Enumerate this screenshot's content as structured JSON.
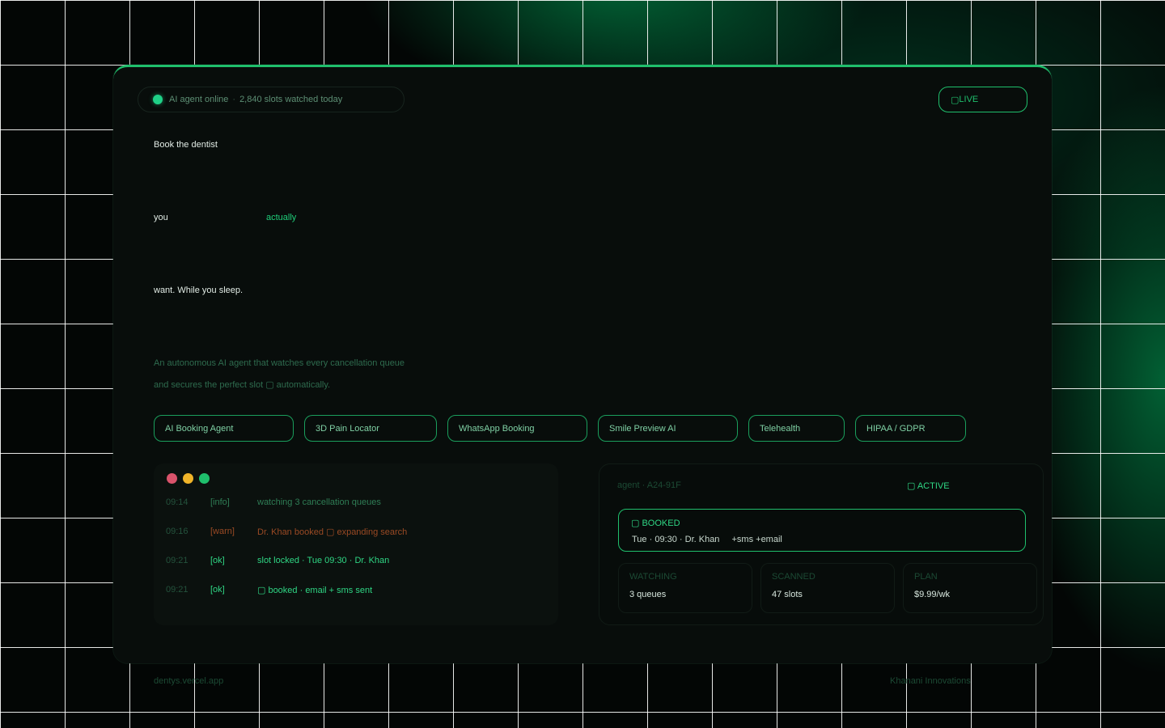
{
  "status": {
    "text": "AI agent online",
    "separator": "·",
    "slots": "2,840 slots watched today"
  },
  "live_badge": {
    "icon": "▢",
    "label": "LIVE"
  },
  "hero": {
    "line1": "Book the dentist",
    "line2": "you",
    "line2_accent": "actually",
    "line3": "want. While you sleep."
  },
  "description": {
    "line1": "An autonomous AI agent that watches every cancellation queue",
    "line2": "and secures the perfect slot ▢ automatically."
  },
  "features": [
    "AI Booking Agent",
    "3D Pain Locator",
    "WhatsApp Booking",
    "Smile Preview AI",
    "Telehealth",
    "HIPAA / GDPR"
  ],
  "terminal": {
    "logs": [
      {
        "time": "09:14",
        "level": "[info]",
        "message": "watching 3 cancellation queues",
        "kind": "info"
      },
      {
        "time": "09:16",
        "level": "[warn]",
        "message": "Dr. Khan booked ▢ expanding search",
        "kind": "warn"
      },
      {
        "time": "09:21",
        "level": "[ok]",
        "message": "slot locked · Tue 09:30 · Dr. Khan",
        "kind": "ok"
      },
      {
        "time": "09:21",
        "level": "[ok]",
        "message": "▢ booked · email + sms sent",
        "kind": "ok"
      }
    ]
  },
  "agent": {
    "id": "agent · A24-91F",
    "status": "▢ ACTIVE",
    "booked": {
      "title": "▢ BOOKED",
      "detail": "Tue · 09:30 · Dr. Khan",
      "extras": "+sms  +email"
    },
    "stats": [
      {
        "label": "WATCHING",
        "value": "3 queues"
      },
      {
        "label": "SCANNED",
        "value": "47 slots"
      },
      {
        "label": "PLAN",
        "value": "$9.99/wk"
      }
    ]
  },
  "footer": {
    "left": "dentys.vercel.app",
    "right": "Khanani Innovations"
  },
  "colors": {
    "accent": "#1fbf6c",
    "background": "#030605",
    "card": "#080d0b",
    "warn": "#9a4a24"
  }
}
